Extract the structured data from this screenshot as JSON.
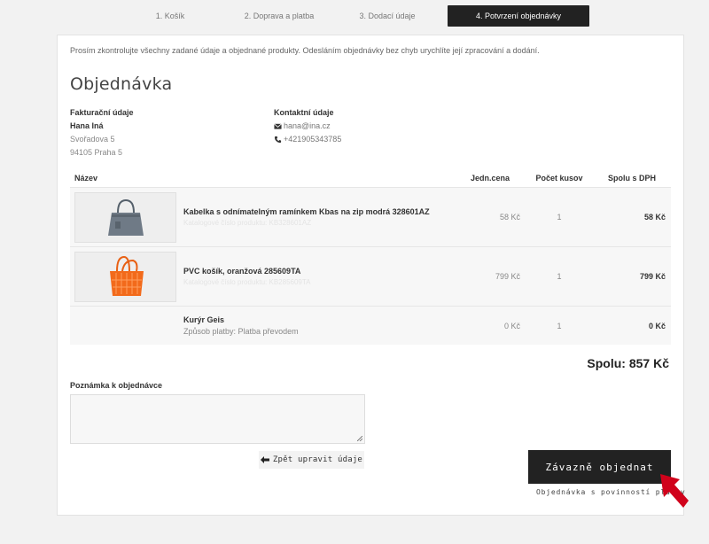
{
  "steps": [
    {
      "label": "1. Košík"
    },
    {
      "label": "2. Doprava a platba"
    },
    {
      "label": "3. Dodací údaje"
    },
    {
      "label": "4. Potvrzení objednávky"
    }
  ],
  "intro": "Prosím zkontrolujte všechny zadané údaje a objednané produkty. Odesláním objednávky bez chyb urychlíte její zpracování a dodání.",
  "title": "Objednávka",
  "billing": {
    "heading": "Fakturační údaje",
    "name": "Hana Iná",
    "street": "Svořadova 5",
    "city": "94105 Praha 5"
  },
  "contact": {
    "heading": "Kontaktní údaje",
    "email": "hana@ina.cz",
    "phone": "+421905343785",
    "email_icon": "envelope-icon",
    "phone_icon": "phone-icon"
  },
  "table": {
    "headers": {
      "name": "Název",
      "price": "Jedn.cena",
      "qty": "Počet kusov",
      "sum": "Spolu s DPH"
    },
    "rows": [
      {
        "name": "Kabelka s odnímatelným ramínkem Kbas na zip modrá 328601AZ",
        "code": "Katalogové číslo produktu: KB328601AZ",
        "price": "58 Kč",
        "qty": "1",
        "sum": "58 Kč"
      },
      {
        "name": "PVC košík, oranžová 285609TA",
        "code": "Katalogové číslo produktu: KB285609TA",
        "price": "799 Kč",
        "qty": "1",
        "sum": "799 Kč"
      },
      {
        "name": "Kurýr Geis",
        "code": "Způsob platby: Platba převodem",
        "price": "0 Kč",
        "qty": "1",
        "sum": "0 Kč"
      }
    ]
  },
  "total": "Spolu: 857 Kč",
  "note": {
    "label": "Poznámka k objednávce",
    "value": "",
    "placeholder": ""
  },
  "back_button": "Zpět upravit údaje",
  "order_button": "Závazně objednat",
  "order_sub": "Objednávka s povinností platby",
  "colors": {
    "dark": "#222222",
    "accent_arrow": "#d0021b",
    "bag_blue": "#6f7a86",
    "basket_orange": "#f26a1b"
  }
}
